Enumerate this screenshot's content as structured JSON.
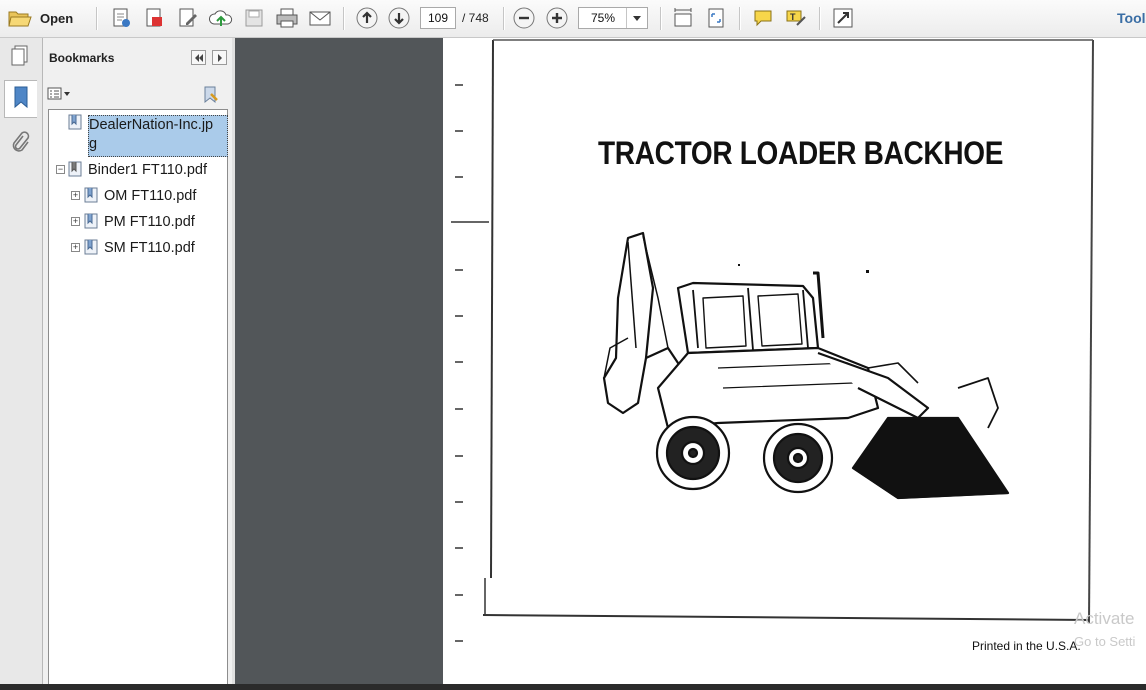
{
  "toolbar": {
    "open_label": "Open",
    "current_page": "109",
    "page_total": "/ 748",
    "zoom": "75%",
    "tools_label": "Tools"
  },
  "sidebar_panel": {
    "title": "Bookmarks",
    "items": [
      {
        "label_line1": "DealerNation-Inc.jp",
        "label_line2": "g",
        "selected": true
      },
      {
        "label": "Binder1 FT110.pdf",
        "expanded": true
      },
      {
        "label": "OM FT110.pdf",
        "expanded": false
      },
      {
        "label": "PM FT110.pdf",
        "expanded": false
      },
      {
        "label": "SM FT110.pdf",
        "expanded": false
      }
    ]
  },
  "document": {
    "title": "TRACTOR LOADER BACKHOE",
    "footer": "Printed in the U.S.A.",
    "illustration": "tractor-loader-backhoe-drawing"
  },
  "watermark": {
    "line1": "Activate",
    "line2": "Go to Setti"
  },
  "colors": {
    "doc_background": "#525659",
    "selection": "#aacbea",
    "tools_link": "#3a6ea5"
  }
}
